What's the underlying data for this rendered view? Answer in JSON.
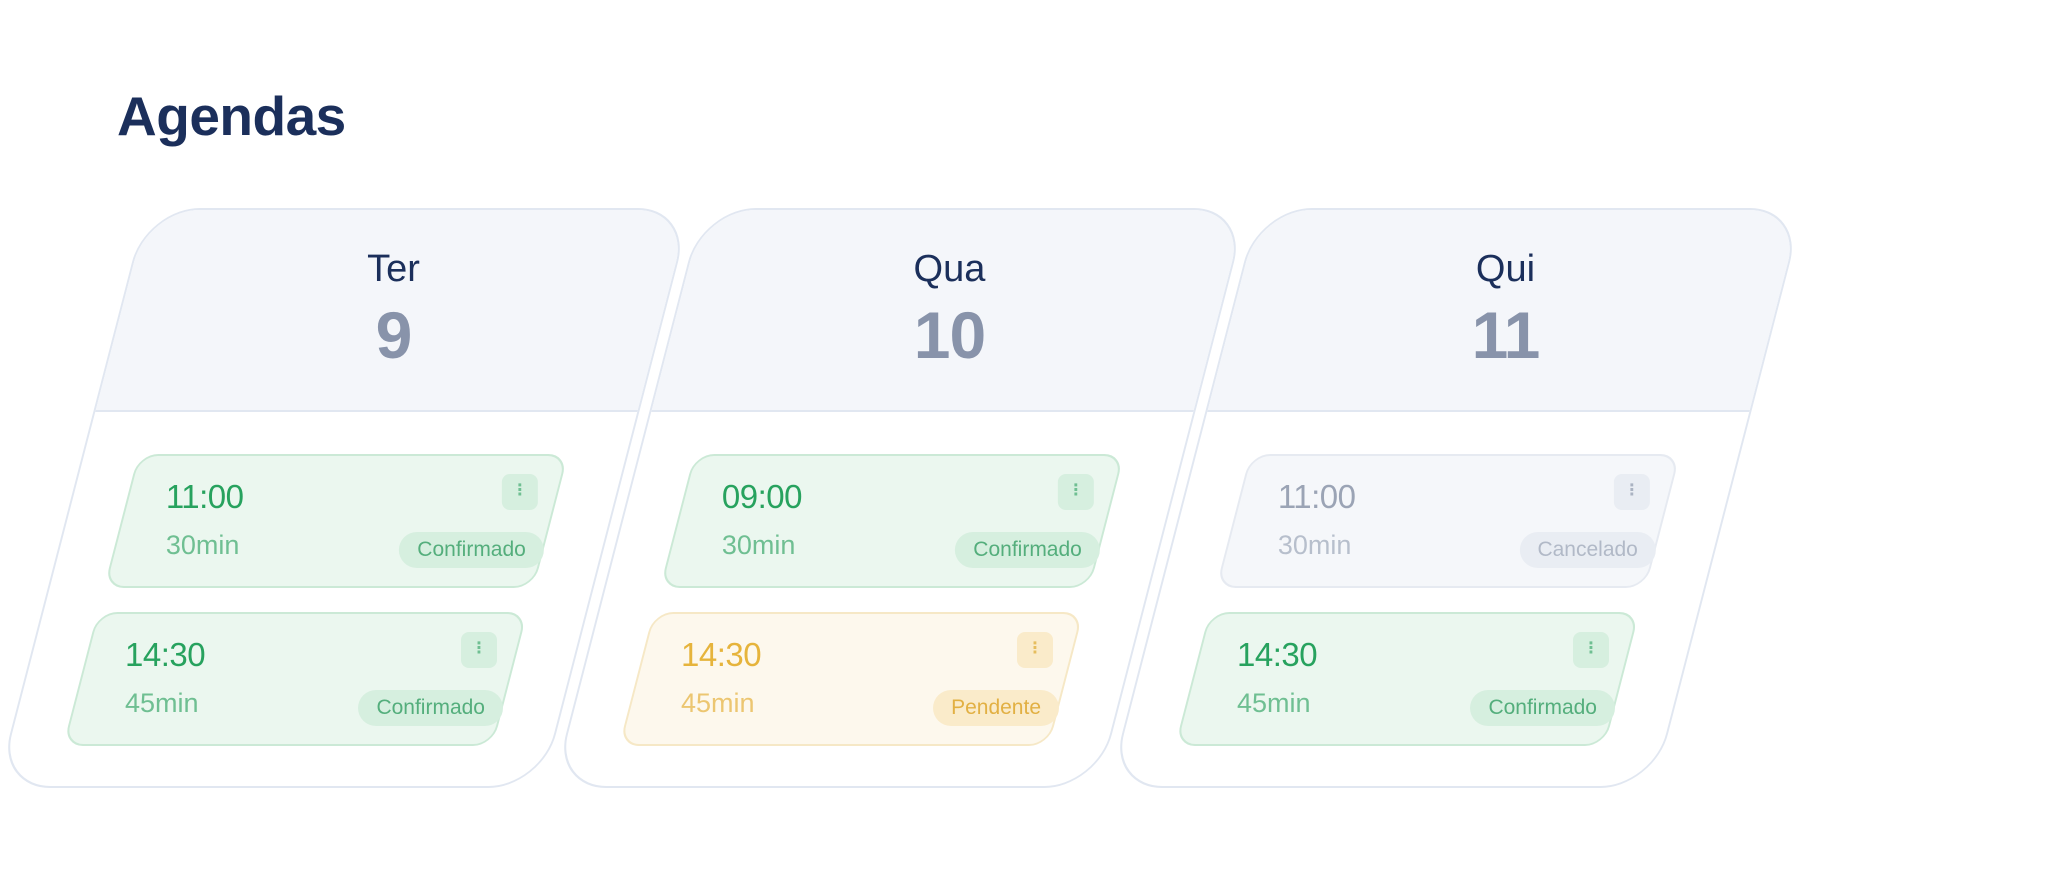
{
  "page": {
    "title": "Agendas"
  },
  "status_colors": {
    "confirmed": "#27a25e",
    "pending": "#e6b43c",
    "cancelled": "#9ba4b5"
  },
  "icons": {
    "menu": "more-vertical-icon"
  },
  "days": [
    {
      "name": "Ter",
      "number": "9",
      "appointments": [
        {
          "time": "11:00",
          "duration": "30min",
          "status": "Confirmado",
          "state": "confirmed",
          "menu_glyph": "⋮"
        },
        {
          "time": "14:30",
          "duration": "45min",
          "status": "Confirmado",
          "state": "confirmed",
          "menu_glyph": "⋮"
        }
      ]
    },
    {
      "name": "Qua",
      "number": "10",
      "appointments": [
        {
          "time": "09:00",
          "duration": "30min",
          "status": "Confirmado",
          "state": "confirmed",
          "menu_glyph": "⋮"
        },
        {
          "time": "14:30",
          "duration": "45min",
          "status": "Pendente",
          "state": "pending",
          "menu_glyph": "⋮"
        }
      ]
    },
    {
      "name": "Qui",
      "number": "11",
      "appointments": [
        {
          "time": "11:00",
          "duration": "30min",
          "status": "Cancelado",
          "state": "cancelled",
          "menu_glyph": "⋮"
        },
        {
          "time": "14:30",
          "duration": "45min",
          "status": "Confirmado",
          "state": "confirmed",
          "menu_glyph": "⋮"
        }
      ]
    }
  ]
}
